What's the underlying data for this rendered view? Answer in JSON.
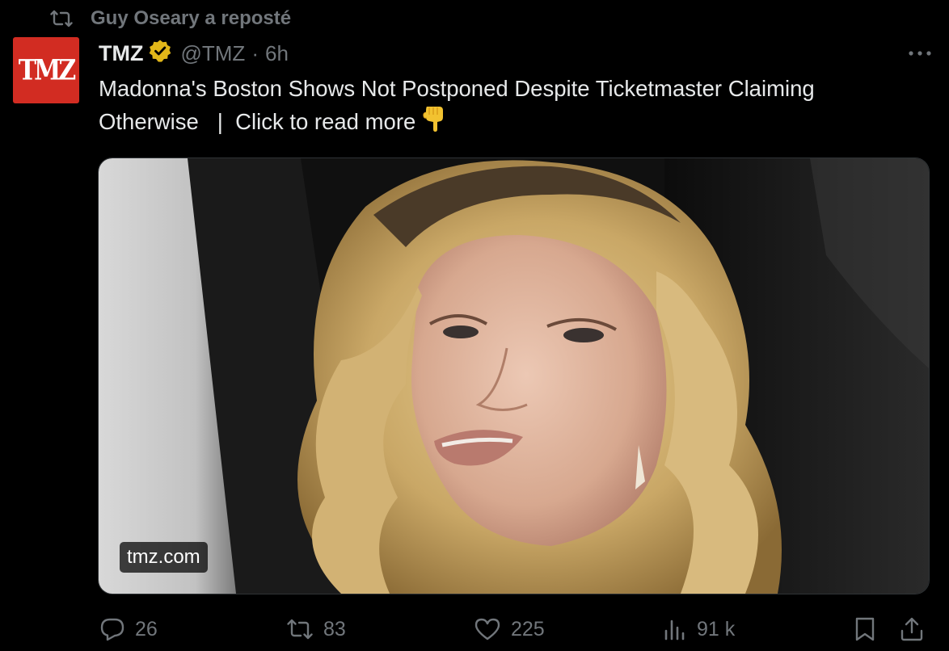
{
  "repost": {
    "icon": "repost-icon",
    "text": "Guy Oseary a reposté"
  },
  "author": {
    "avatar_text": "TMZ",
    "avatar_color": "#d22c22",
    "name": "TMZ",
    "verified_badge_color": "#e2b719",
    "handle": "@TMZ",
    "separator": "·",
    "time": "6h"
  },
  "tweet": {
    "text_line1": "Madonna's Boston Shows Not Postponed Despite Ticketmaster Claiming",
    "text_line2": "Otherwise   |  Click to read more",
    "emoji": "backhand-index-pointing-down"
  },
  "card": {
    "domain": "tmz.com"
  },
  "actions": {
    "replies": "26",
    "reposts": "83",
    "likes": "225",
    "views": "91 k"
  },
  "colors": {
    "background": "#000000",
    "text_primary": "#e7e9ea",
    "text_secondary": "#71767b"
  }
}
